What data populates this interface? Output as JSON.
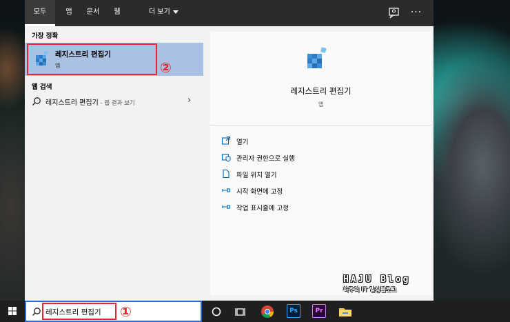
{
  "tabs": {
    "all": "모두",
    "apps": "앱",
    "documents": "문서",
    "web": "웹",
    "more": "더 보기"
  },
  "left": {
    "best_match_heading": "가장 정확",
    "best_match": {
      "title": "레지스트리 편집기",
      "subtitle": "앱"
    },
    "web_heading": "웹 검색",
    "web_result": {
      "query": "레지스트리 편집기",
      "hint": " - 웹 결과 보기"
    }
  },
  "detail": {
    "title": "레지스트리 편집기",
    "subtitle": "앱",
    "actions": [
      {
        "label": "열기",
        "icon": "open-icon"
      },
      {
        "label": "관리자 권한으로 실행",
        "icon": "shield-run-icon"
      },
      {
        "label": "파일 위치 열기",
        "icon": "file-location-icon"
      },
      {
        "label": "시작 화면에 고정",
        "icon": "pin-icon"
      },
      {
        "label": "작업 표시줄에 고정",
        "icon": "pin-icon"
      }
    ]
  },
  "annotations": {
    "step1": "①",
    "step2": "②"
  },
  "watermark": {
    "title": "HAJU Blog",
    "subtitle": "하주의 IT 일상블로그"
  },
  "taskbar": {
    "search_value": "레지스트리 편집기",
    "photoshop_label": "Ps",
    "premiere_label": "Pr"
  },
  "colors": {
    "selection": "#a9c2e3",
    "accent": "#2b6cd4",
    "annotation_red": "#e8262f",
    "tab_bar": "#2b2b2b"
  }
}
